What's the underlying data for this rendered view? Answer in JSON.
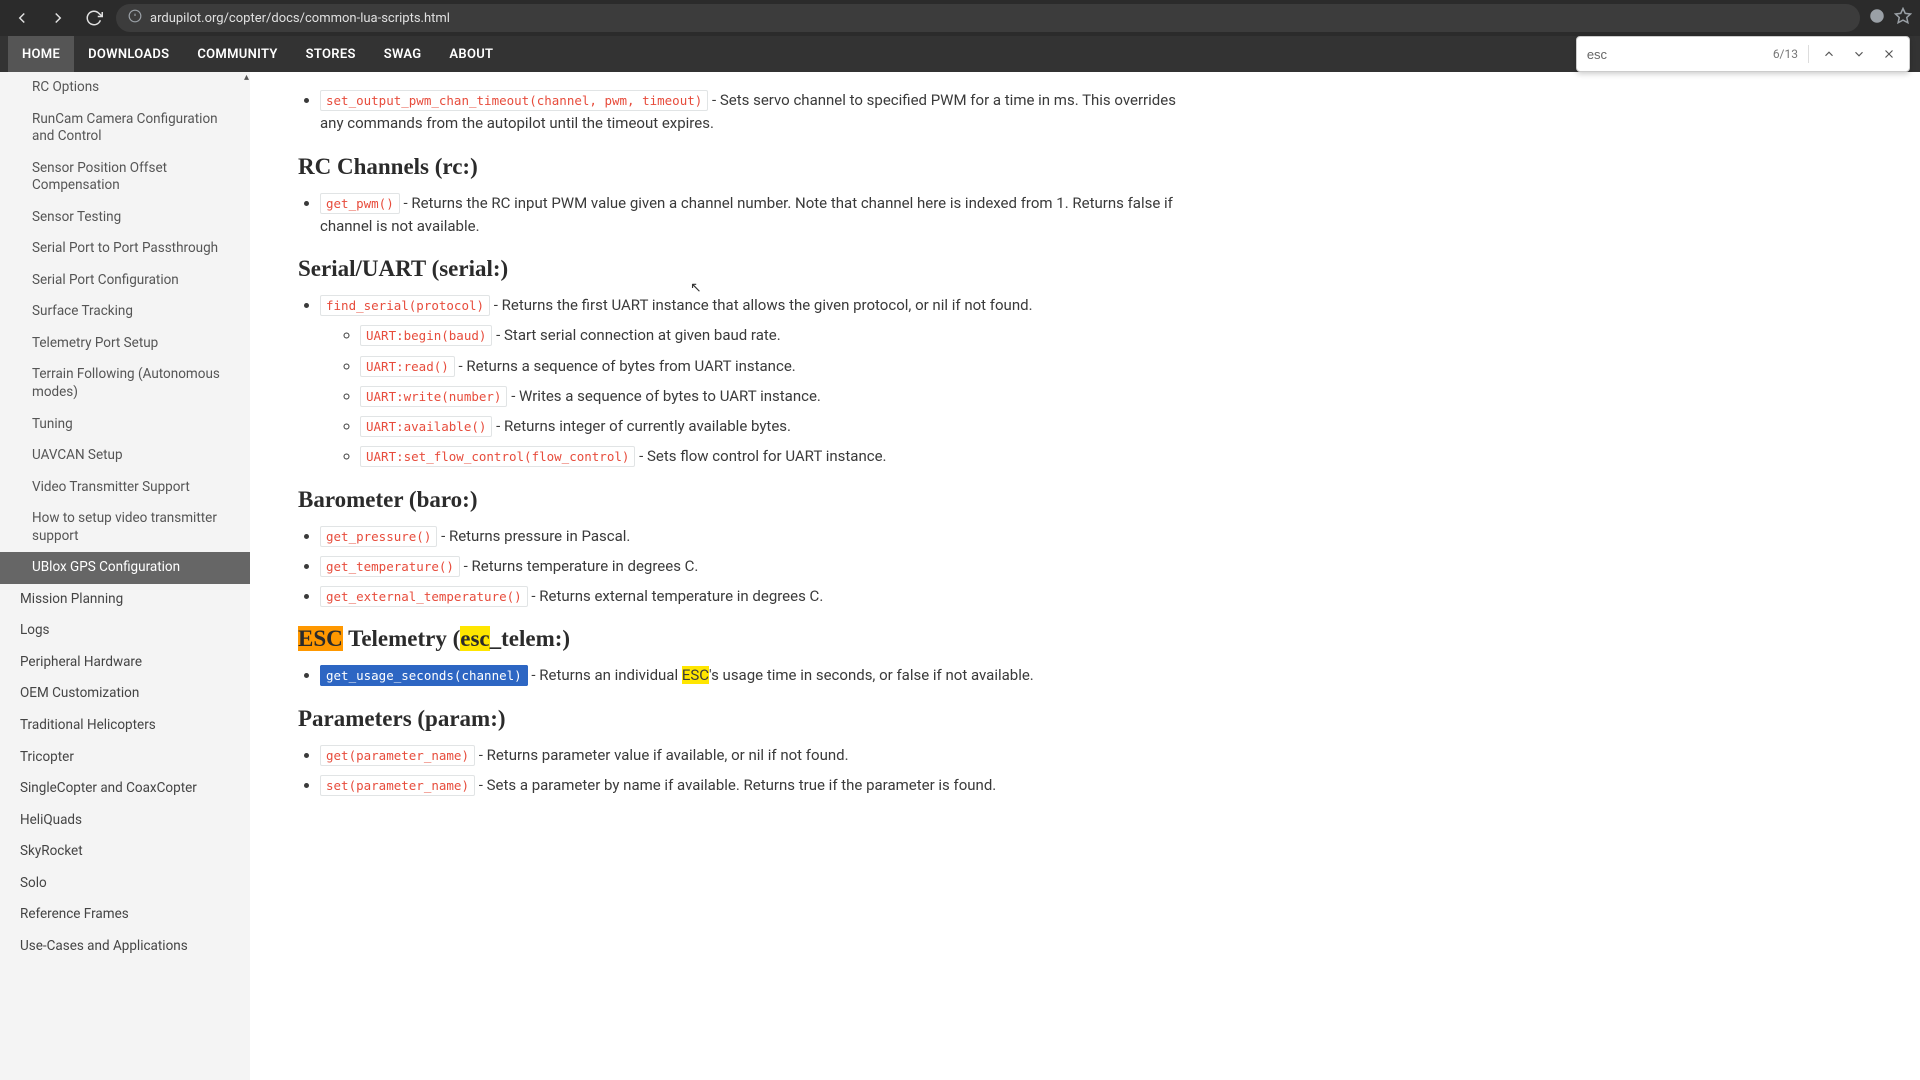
{
  "browser": {
    "url": "ardupilot.org/copter/docs/common-lua-scripts.html"
  },
  "find": {
    "query": "esc",
    "count": "6/13"
  },
  "topnav": [
    "HOME",
    "DOWNLOADS",
    "COMMUNITY",
    "STORES",
    "SWAG",
    "ABOUT"
  ],
  "sidebar": {
    "items": [
      "RC Options",
      "RunCam Camera Configuration and Control",
      "Sensor Position Offset Compensation",
      "Sensor Testing",
      "Serial Port to Port Passthrough",
      "Serial Port Configuration",
      "Surface Tracking",
      "Telemetry Port Setup",
      "Terrain Following (Autonomous modes)",
      "Tuning",
      "UAVCAN Setup",
      "Video Transmitter Support",
      "How to setup video transmitter support",
      "UBlox GPS Configuration"
    ],
    "items2": [
      "Mission Planning",
      "Logs",
      "Peripheral Hardware",
      "OEM Customization",
      "Traditional Helicopters",
      "Tricopter",
      "SingleCopter and CoaxCopter",
      "HeliQuads",
      "SkyRocket",
      "Solo",
      "Reference Frames",
      "Use-Cases and Applications"
    ]
  },
  "content": {
    "intro": {
      "code": "set_output_pwm_chan_timeout(channel, pwm, timeout)",
      "text": " - Sets servo channel to specified PWM for a time in ms. This overrides any commands from the autopilot until the timeout expires."
    },
    "sections": [
      {
        "title": "RC Channels (rc:)",
        "items": [
          {
            "code": "get_pwm()",
            "text": " - Returns the RC input PWM value given a channel number. Note that channel here is indexed from 1. Returns false if channel is not available."
          }
        ]
      },
      {
        "title": "Serial/UART (serial:)",
        "items": [
          {
            "code": "find_serial(protocol)",
            "text": " - Returns the first UART instance that allows the given protocol, or nil if not found.",
            "sub": [
              {
                "code": "UART:begin(baud)",
                "text": " - Start serial connection at given baud rate."
              },
              {
                "code": "UART:read()",
                "text": " - Returns a sequence of bytes from UART instance."
              },
              {
                "code": "UART:write(number)",
                "text": " - Writes a sequence of bytes to UART instance."
              },
              {
                "code": "UART:available()",
                "text": " - Returns integer of currently available bytes."
              },
              {
                "code": "UART:set_flow_control(flow_control)",
                "text": " - Sets flow control for UART instance."
              }
            ]
          }
        ]
      },
      {
        "title": "Barometer (baro:)",
        "items": [
          {
            "code": "get_pressure()",
            "text": " - Returns pressure in Pascal."
          },
          {
            "code": "get_temperature()",
            "text": " - Returns temperature in degrees C."
          },
          {
            "code": "get_external_temperature()",
            "text": " - Returns external temperature in degrees C."
          }
        ]
      },
      {
        "title_html": "esc_telem",
        "title_pre": "ESC",
        "title_mid": " Telemetry (",
        "title_hl": "esc",
        "title_post": "_telem:)",
        "items": [
          {
            "code": "get_usage_seconds(channel)",
            "selected": true,
            "text_pre": " - Returns an individual ",
            "text_hl": "ESC",
            "text_post": "'s usage time in seconds, or false if not available."
          }
        ]
      },
      {
        "title": "Parameters (param:)",
        "items": [
          {
            "code": "get(parameter_name)",
            "text": " - Returns parameter value if available, or nil if not found."
          },
          {
            "code": "set(parameter_name)",
            "text": " - Sets a parameter by name if available. Returns true if the parameter is found."
          }
        ]
      }
    ]
  }
}
